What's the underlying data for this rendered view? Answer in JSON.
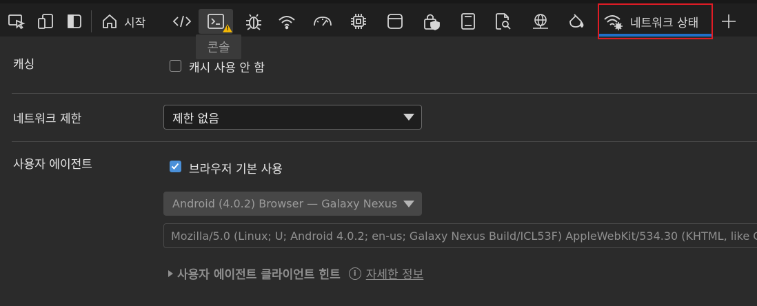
{
  "toolbar": {
    "tabs": {
      "welcome_label": "시작",
      "network_conditions_label": "네트워크 상태"
    },
    "tooltip": "콘솔",
    "icons": [
      "inspect-icon",
      "device-emulation-icon",
      "toggle-sidebar-icon",
      "home-icon",
      "elements-icon",
      "console-icon",
      "sources-icon",
      "network-icon",
      "performance-icon",
      "memory-icon",
      "application-icon",
      "security-icon",
      "lighthouse-icon",
      "issues-icon",
      "network-console-icon",
      "rendering-icon",
      "network-conditions-icon",
      "plus-icon"
    ],
    "active_outline_color": "#e01c25",
    "active_underline_color": "#1f6fc9"
  },
  "caching": {
    "label": "캐싱",
    "checkbox_label": "캐시 사용 안 함",
    "checked": false
  },
  "throttling": {
    "label": "네트워크 제한",
    "selected": "제한 없음"
  },
  "user_agent": {
    "label": "사용자 에이전트",
    "checkbox_label": "브라우저 기본 사용",
    "checked": true,
    "device_selected": "Android (4.0.2) Browser — Galaxy Nexus",
    "ua_string": "Mozilla/5.0 (Linux; U; Android 4.0.2; en-us; Galaxy Nexus Build/ICL53F) AppleWebKit/534.30 (KHTML, like Ge",
    "client_hints_label": "사용자 에이전트 클라이언트 힌트",
    "learn_more_label": "자세한 정보",
    "checkbox_color": "#4a90d9"
  }
}
